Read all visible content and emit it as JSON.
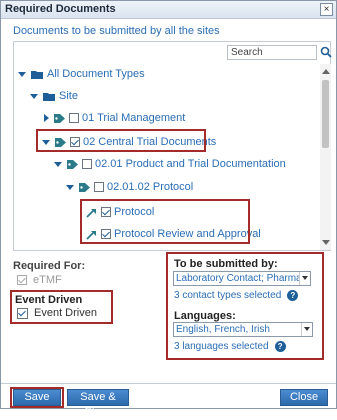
{
  "dialog": {
    "title": "Required Documents",
    "close_glyph": "×"
  },
  "section_head": "Documents to be submitted by all the sites",
  "search": {
    "placeholder": "Search",
    "value": ""
  },
  "tree": [
    {
      "label": "All Document Types"
    },
    {
      "label": "Site"
    },
    {
      "label": "01 Trial Management"
    },
    {
      "label": "02 Central Trial Documents"
    },
    {
      "label": "02.01 Product and Trial Documentation"
    },
    {
      "label": "02.01.02 Protocol"
    },
    {
      "label": "Protocol"
    },
    {
      "label": "Protocol Review and Approval"
    }
  ],
  "required_for": {
    "label": "Required For:",
    "option": "eTMF"
  },
  "event_driven": {
    "label": "Event Driven",
    "option": "Event Driven"
  },
  "to_be_submitted": {
    "label": "To be submitted by:",
    "selected_value": "Laboratory Contact; Pharmacist",
    "summary": "3 contact types selected"
  },
  "languages": {
    "label": "Languages:",
    "selected_value": "English, French, Irish",
    "summary": "3 languages selected"
  },
  "footer": {
    "save": "Save",
    "save_close": "Save & Close",
    "close": "Close"
  },
  "colors": {
    "link_blue": "#2a6db5",
    "button_blue": "#2c6aac",
    "highlight": "#a52a2a"
  },
  "icons": [
    "search-icon",
    "folder-icon",
    "tag-icon",
    "document-icon",
    "link-icon",
    "help-icon",
    "close-icon"
  ]
}
